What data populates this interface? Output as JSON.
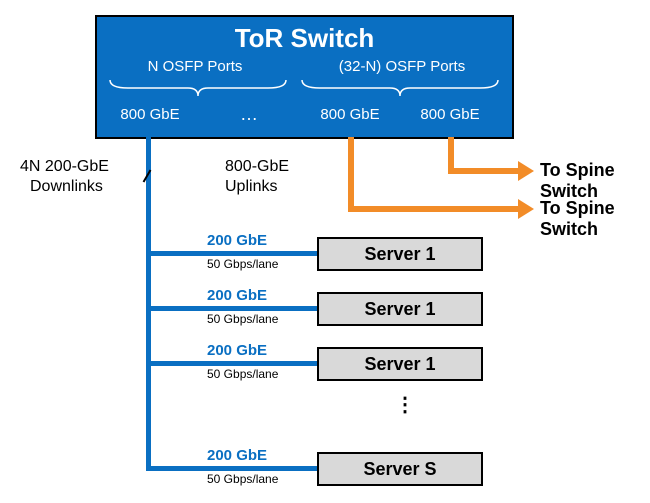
{
  "switch": {
    "title": "ToR Switch",
    "left_group_label": "N OSFP Ports",
    "right_group_label": "(32-N) OSFP Ports",
    "speed1": "800 GbE",
    "speed2": "800 GbE",
    "speed3": "800 GbE",
    "ellipsis": "…"
  },
  "downlinks": {
    "label_line1": "4N 200-GbE",
    "label_line2": "Downlinks"
  },
  "uplinks": {
    "label_line1": "800-GbE",
    "label_line2": "Uplinks",
    "dest1": "To Spine Switch",
    "dest2": "To Spine Switch"
  },
  "servers": [
    {
      "speed": "200 GbE",
      "lane": "50 Gbps/lane",
      "name": "Server 1"
    },
    {
      "speed": "200 GbE",
      "lane": "50 Gbps/lane",
      "name": "Server 1"
    },
    {
      "speed": "200 GbE",
      "lane": "50 Gbps/lane",
      "name": "Server 1"
    },
    {
      "speed": "200 GbE",
      "lane": "50 Gbps/lane",
      "name": "Server S"
    }
  ],
  "vdots": "⋮",
  "chart_data": {
    "type": "diagram",
    "title": "ToR Switch connectivity",
    "nodes": [
      {
        "id": "tor",
        "label": "ToR Switch",
        "ports_total": 32,
        "port_type": "OSFP",
        "port_speed": "800 GbE",
        "downlink_ports": "N",
        "uplink_ports": "32-N"
      },
      {
        "id": "server1",
        "label": "Server 1"
      },
      {
        "id": "server2",
        "label": "Server 1"
      },
      {
        "id": "server3",
        "label": "Server 1"
      },
      {
        "id": "serverS",
        "label": "Server S"
      },
      {
        "id": "spine1",
        "label": "Spine Switch"
      },
      {
        "id": "spine2",
        "label": "Spine Switch"
      }
    ],
    "edges": [
      {
        "from": "tor",
        "to": "server1",
        "speed": "200 GbE",
        "lane_rate": "50 Gbps/lane"
      },
      {
        "from": "tor",
        "to": "server2",
        "speed": "200 GbE",
        "lane_rate": "50 Gbps/lane"
      },
      {
        "from": "tor",
        "to": "server3",
        "speed": "200 GbE",
        "lane_rate": "50 Gbps/lane"
      },
      {
        "from": "tor",
        "to": "serverS",
        "speed": "200 GbE",
        "lane_rate": "50 Gbps/lane"
      },
      {
        "from": "tor",
        "to": "spine1",
        "speed": "800 GbE"
      },
      {
        "from": "tor",
        "to": "spine2",
        "speed": "800 GbE"
      }
    ],
    "annotations": {
      "downlinks_total": "4N 200-GbE Downlinks",
      "uplinks": "800-GbE Uplinks"
    }
  }
}
